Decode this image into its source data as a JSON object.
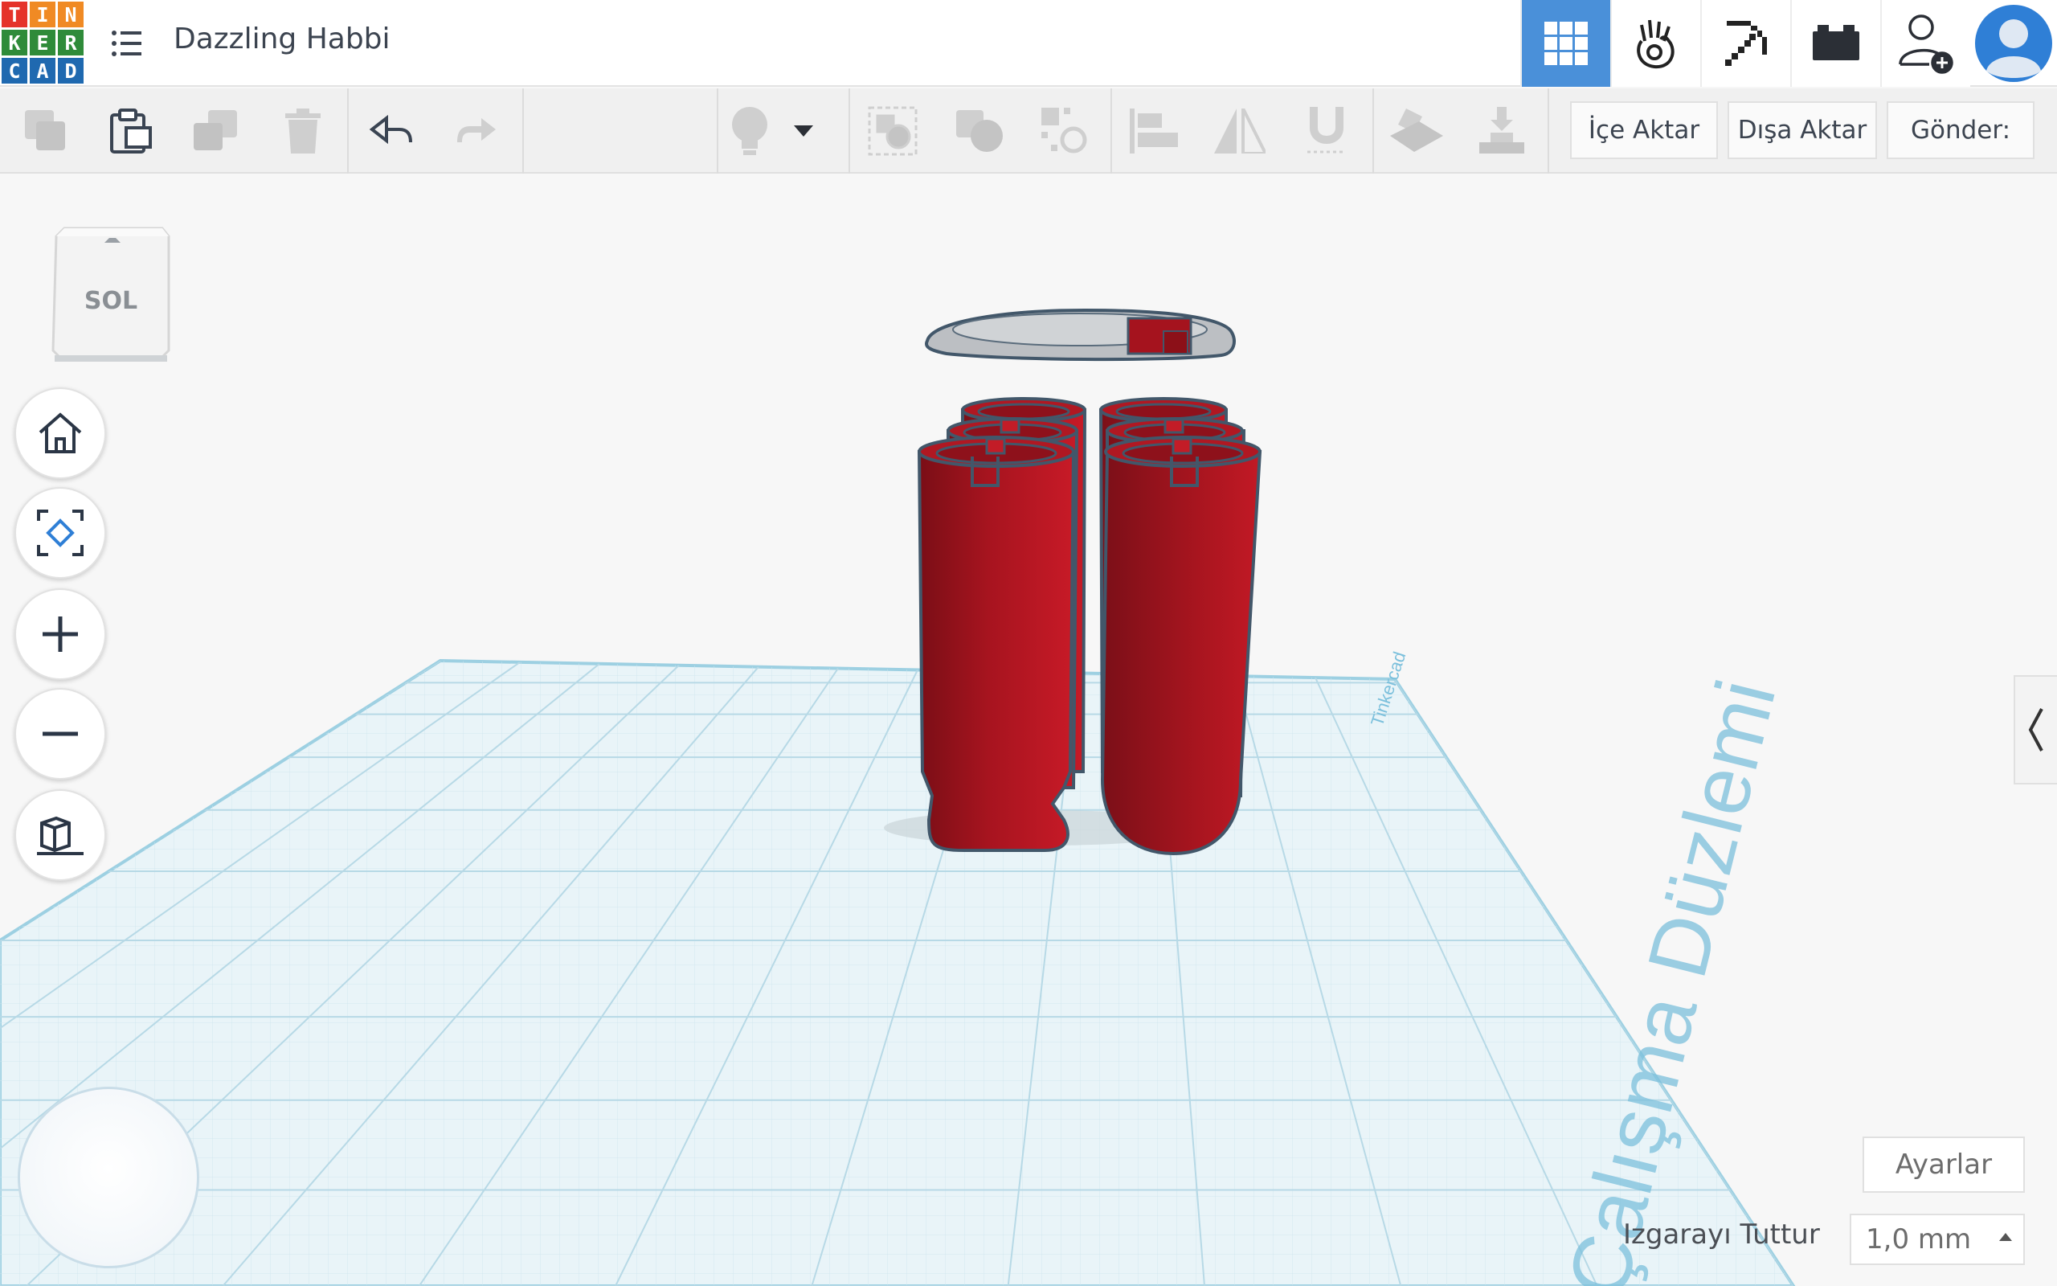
{
  "app": {
    "logo_letters": [
      "T",
      "I",
      "N",
      "K",
      "E",
      "R",
      "C",
      "A",
      "D"
    ],
    "logo_colors": [
      "#e5332a",
      "#f08a24",
      "#f08a24",
      "#2f8b3a",
      "#2f8b3a",
      "#2f8b3a",
      "#1f69b0",
      "#1f69b0",
      "#1f69b0"
    ],
    "project_title": "Dazzling Habbi"
  },
  "header": {
    "nav": [
      {
        "name": "3d-design-view-icon",
        "active": true
      },
      {
        "name": "codeblocks-icon",
        "active": false
      },
      {
        "name": "minecraft-pickaxe-icon",
        "active": false
      },
      {
        "name": "bricks-icon",
        "active": false
      },
      {
        "name": "invite-user-icon",
        "active": false
      }
    ]
  },
  "toolbar": {
    "import_label": "İçe Aktar",
    "export_label": "Dışa Aktar",
    "send_label": "Gönder:"
  },
  "viewcube": {
    "face_label": "SOL"
  },
  "workplane": {
    "label": "Çalışma Düzlemi",
    "brand_mark": "Tinkercad"
  },
  "footer": {
    "settings_label": "Ayarlar",
    "snap_label": "Izgarayı Tuttur",
    "snap_value": "1,0 mm"
  },
  "colors": {
    "accent": "#4a90d9",
    "shape_red": "#a3131e",
    "grid_line": "#bfdde8"
  }
}
